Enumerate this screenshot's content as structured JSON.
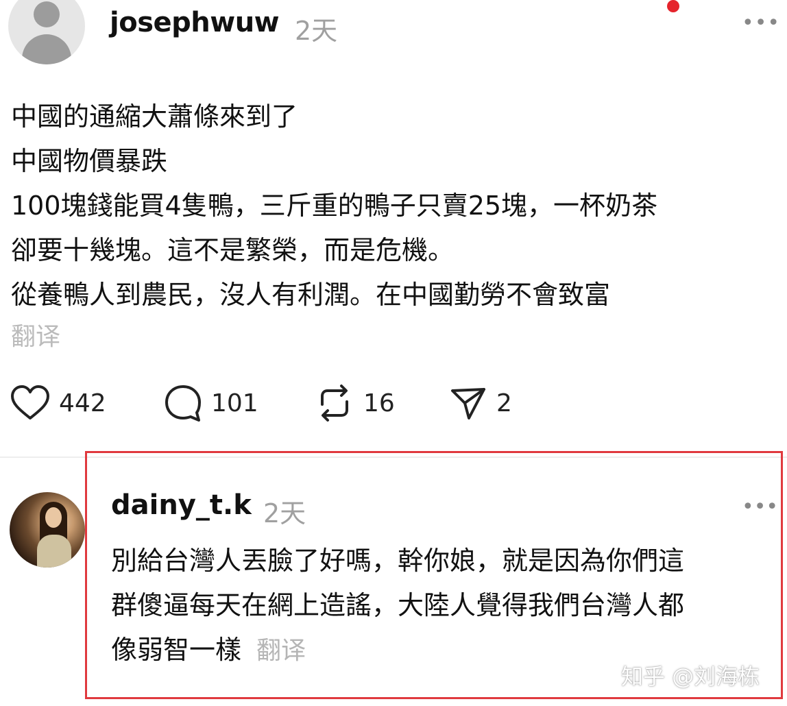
{
  "post": {
    "username": "josephwuw",
    "time": "2天",
    "more_icon": "more-horizontal-icon",
    "lines": [
      "中國的通縮大蕭條來到了",
      "中國物價暴跌",
      "100塊錢能買4隻鴨，三斤重的鴨子只賣25塊，一杯奶茶",
      "卻要十幾塊。這不是繁榮，而是危機。",
      "從養鴨人到農民，沒人有利潤。在中國勤勞不會致富"
    ],
    "translate": "翻译",
    "actions": {
      "likes": "442",
      "comments": "101",
      "reposts": "16",
      "shares": "2"
    },
    "notification_color": "#e5242c"
  },
  "reply": {
    "username": "dainy_t.k",
    "time": "2天",
    "lines": [
      "別給台灣人丟臉了好嗎，幹你娘，就是因為你們這",
      "群傻逼每天在網上造謠，大陸人覺得我們台灣人都",
      "像弱智一樣"
    ],
    "translate": "翻译",
    "highlight_color": "#e0393e"
  },
  "watermark": "知乎 @刘海栋"
}
